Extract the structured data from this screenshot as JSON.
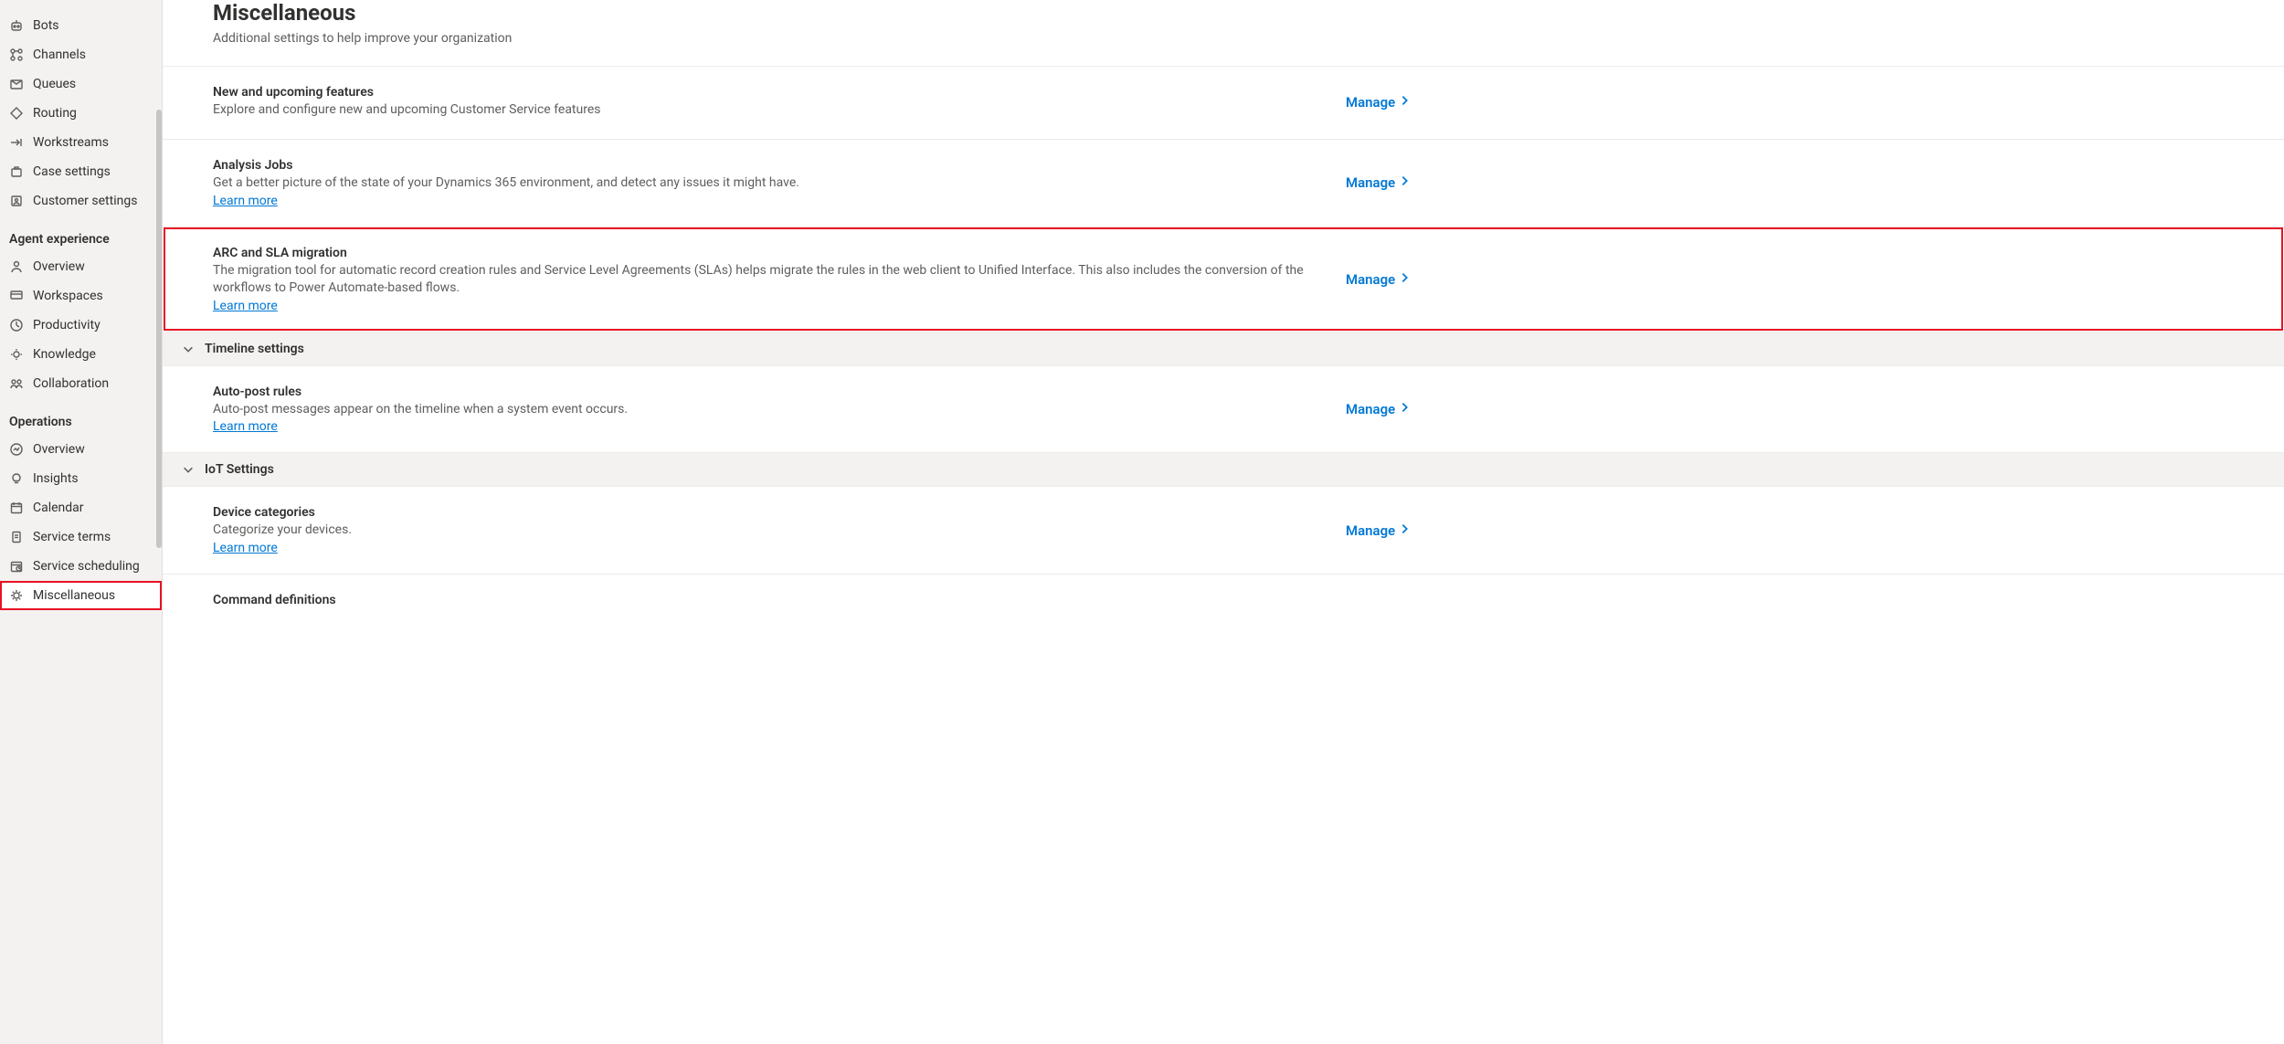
{
  "sidebar": {
    "groups": [
      {
        "label": null,
        "items": [
          {
            "icon": "bot-icon",
            "label": "Bots"
          },
          {
            "icon": "channels-icon",
            "label": "Channels"
          },
          {
            "icon": "queues-icon",
            "label": "Queues"
          },
          {
            "icon": "routing-icon",
            "label": "Routing"
          },
          {
            "icon": "workstreams-icon",
            "label": "Workstreams"
          },
          {
            "icon": "case-icon",
            "label": "Case settings"
          },
          {
            "icon": "customer-icon",
            "label": "Customer settings"
          }
        ]
      },
      {
        "label": "Agent experience",
        "items": [
          {
            "icon": "overview-icon",
            "label": "Overview"
          },
          {
            "icon": "workspaces-icon",
            "label": "Workspaces"
          },
          {
            "icon": "productivity-icon",
            "label": "Productivity"
          },
          {
            "icon": "knowledge-icon",
            "label": "Knowledge"
          },
          {
            "icon": "collaboration-icon",
            "label": "Collaboration"
          }
        ]
      },
      {
        "label": "Operations",
        "items": [
          {
            "icon": "overview-icon",
            "label": "Overview"
          },
          {
            "icon": "insights-icon",
            "label": "Insights"
          },
          {
            "icon": "calendar-icon",
            "label": "Calendar"
          },
          {
            "icon": "terms-icon",
            "label": "Service terms"
          },
          {
            "icon": "scheduling-icon",
            "label": "Service scheduling"
          },
          {
            "icon": "misc-icon",
            "label": "Miscellaneous",
            "selected": true,
            "highlight": true
          }
        ]
      }
    ]
  },
  "header": {
    "title": "Miscellaneous",
    "subtitle": "Additional settings to help improve your organization"
  },
  "manage_label": "Manage",
  "learn_more_label": "Learn more",
  "sections": [
    {
      "title": "New and upcoming features",
      "desc": "Explore and configure new and upcoming Customer Service features",
      "learn_more": false,
      "manage": true
    },
    {
      "title": "Analysis Jobs",
      "desc": "Get a better picture of the state of your Dynamics 365 environment, and detect any issues it might have.",
      "learn_more": true,
      "manage": true
    },
    {
      "title": "ARC and SLA migration",
      "desc": "The migration tool for automatic record creation rules and Service Level Agreements (SLAs) helps migrate the rules in the web client to Unified Interface. This also includes the conversion of the workflows to Power Automate-based flows.",
      "learn_more": true,
      "manage": true,
      "highlight": true
    }
  ],
  "sub1_label": "Timeline settings",
  "sub1_sections": [
    {
      "title": "Auto-post rules",
      "desc": "Auto-post messages appear on the timeline when a system event occurs.",
      "learn_more": true,
      "manage": true
    }
  ],
  "sub2_label": "IoT Settings",
  "sub2_sections": [
    {
      "title": "Device categories",
      "desc": "Categorize your devices.",
      "learn_more": true,
      "manage": true
    },
    {
      "title": "Command definitions",
      "desc": "",
      "learn_more": false,
      "manage": false
    }
  ]
}
